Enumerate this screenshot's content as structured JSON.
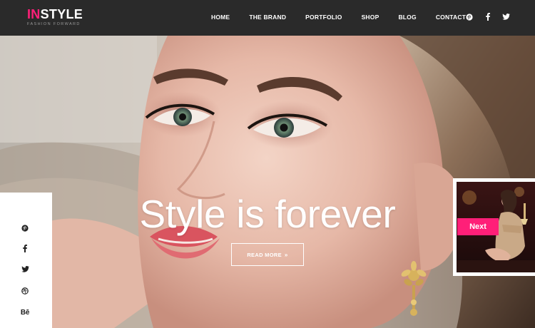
{
  "brand": {
    "prefix": "IN",
    "suffix": "STYLE",
    "tagline": "FASHION FORWARD",
    "accent_color": "#ff1f78"
  },
  "nav": {
    "items": [
      {
        "label": "HOME"
      },
      {
        "label": "THE BRAND"
      },
      {
        "label": "PORTFOLIO"
      },
      {
        "label": "SHOP"
      },
      {
        "label": "BLOG"
      },
      {
        "label": "CONTACT"
      }
    ]
  },
  "header_social": [
    "pinterest-icon",
    "facebook-icon",
    "twitter-icon"
  ],
  "hero": {
    "headline": "Style is forever",
    "cta": "READ MORE",
    "cta_icon": "double-chevron-right-icon"
  },
  "side_share": [
    "pinterest-icon",
    "facebook-icon",
    "twitter-icon",
    "dribbble-icon",
    "behance-icon"
  ],
  "side_share_behance_text": "Bē",
  "next_slide": {
    "label": "Next"
  },
  "colors": {
    "header_bg": "#2a2a2a",
    "accent": "#ff1f78",
    "white": "#ffffff"
  }
}
